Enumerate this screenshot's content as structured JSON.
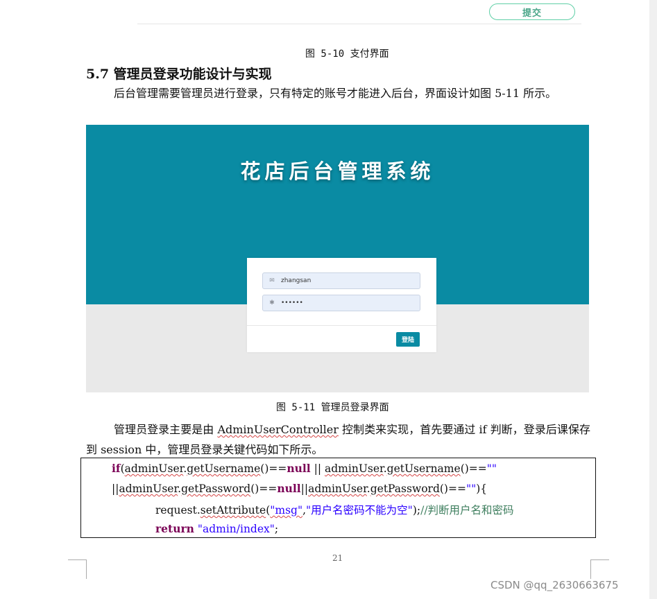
{
  "toolbar": {
    "submit_label": "提交"
  },
  "captions": {
    "fig_5_10": "图 5-10 支付界面",
    "fig_5_11": "图 5-11 管理员登录界面"
  },
  "section": {
    "heading": "5.7 管理员登录功能设计与实现",
    "para1": "后台管理需要管理员进行登录，只有特定的账号才能进入后台，界面设计如图 5-11 所示。",
    "para2_parts": [
      "管理员登录主要是由 ",
      "AdminUserController",
      " 控制类来实现，首先要通过 if 判断，登录后课保存到 session 中，管理员登录关键代码如下所示。"
    ]
  },
  "screenshot": {
    "title": "花店后台管理系统",
    "username_value": "zhangsan",
    "password_value": "••••••",
    "login_button": "登陆",
    "username_icon": "envelope-icon",
    "password_icon": "asterisk-icon"
  },
  "code": {
    "l1": [
      "if",
      "(",
      "adminUser",
      ".",
      "getUsername",
      "()==",
      "null",
      " || ",
      "adminUser",
      ".",
      "getUsername",
      "()==",
      "\"\""
    ],
    "l2": [
      "||",
      "adminUser",
      ".",
      "getPassword",
      "()==",
      "null",
      "||",
      "adminUser",
      ".",
      "getPassword",
      "()==",
      "\"\"",
      "){"
    ],
    "l3": [
      "request.",
      "setAttribute",
      "(",
      "\"msg\"",
      ",",
      "\"用户名密码不能为空\"",
      ");",
      "//判断用户名和密码"
    ],
    "l4": [
      "return",
      " ",
      "\"admin/index\"",
      ";"
    ]
  },
  "footer": {
    "page_number": "21",
    "watermark": "CSDN @qq_2630663675"
  },
  "colors": {
    "banner": "#0a8ba3",
    "submit_border": "#5fcfa6",
    "keyword": "#7a0055",
    "string": "#2a00ff",
    "comment": "#3f7f5f"
  }
}
